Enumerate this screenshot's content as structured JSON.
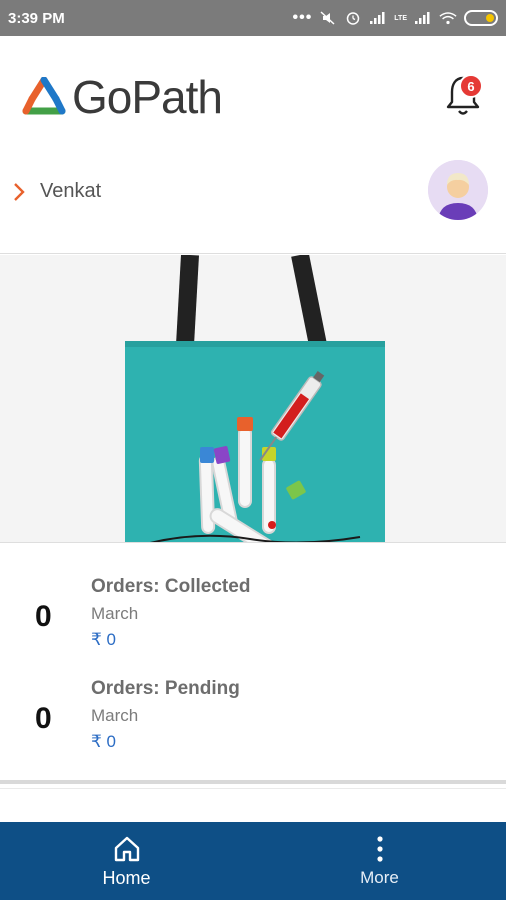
{
  "status_bar": {
    "time": "3:39 PM",
    "lte_label": "LTE"
  },
  "header": {
    "brand_name": "GoPath",
    "notification_count": "6",
    "colors": {
      "badge": "#e53935",
      "brand_orange": "#e8612c",
      "brand_blue": "#1f78c8",
      "brand_green": "#43a047"
    }
  },
  "user": {
    "name": "Venkat",
    "avatar_icon": "user-avatar-icon"
  },
  "banner": {
    "image_icon": "blood-sample-tote-bag-image"
  },
  "stats": [
    {
      "count": "0",
      "label": "Orders: Collected",
      "month": "March",
      "amount": "₹ 0"
    },
    {
      "count": "0",
      "label": "Orders: Pending",
      "month": "March",
      "amount": "₹ 0"
    }
  ],
  "bottom_nav": {
    "items": [
      {
        "label": "Home",
        "icon": "home-icon",
        "active": true
      },
      {
        "label": "More",
        "icon": "more-vertical-icon",
        "active": false
      }
    ],
    "color": "#0e4f86"
  }
}
